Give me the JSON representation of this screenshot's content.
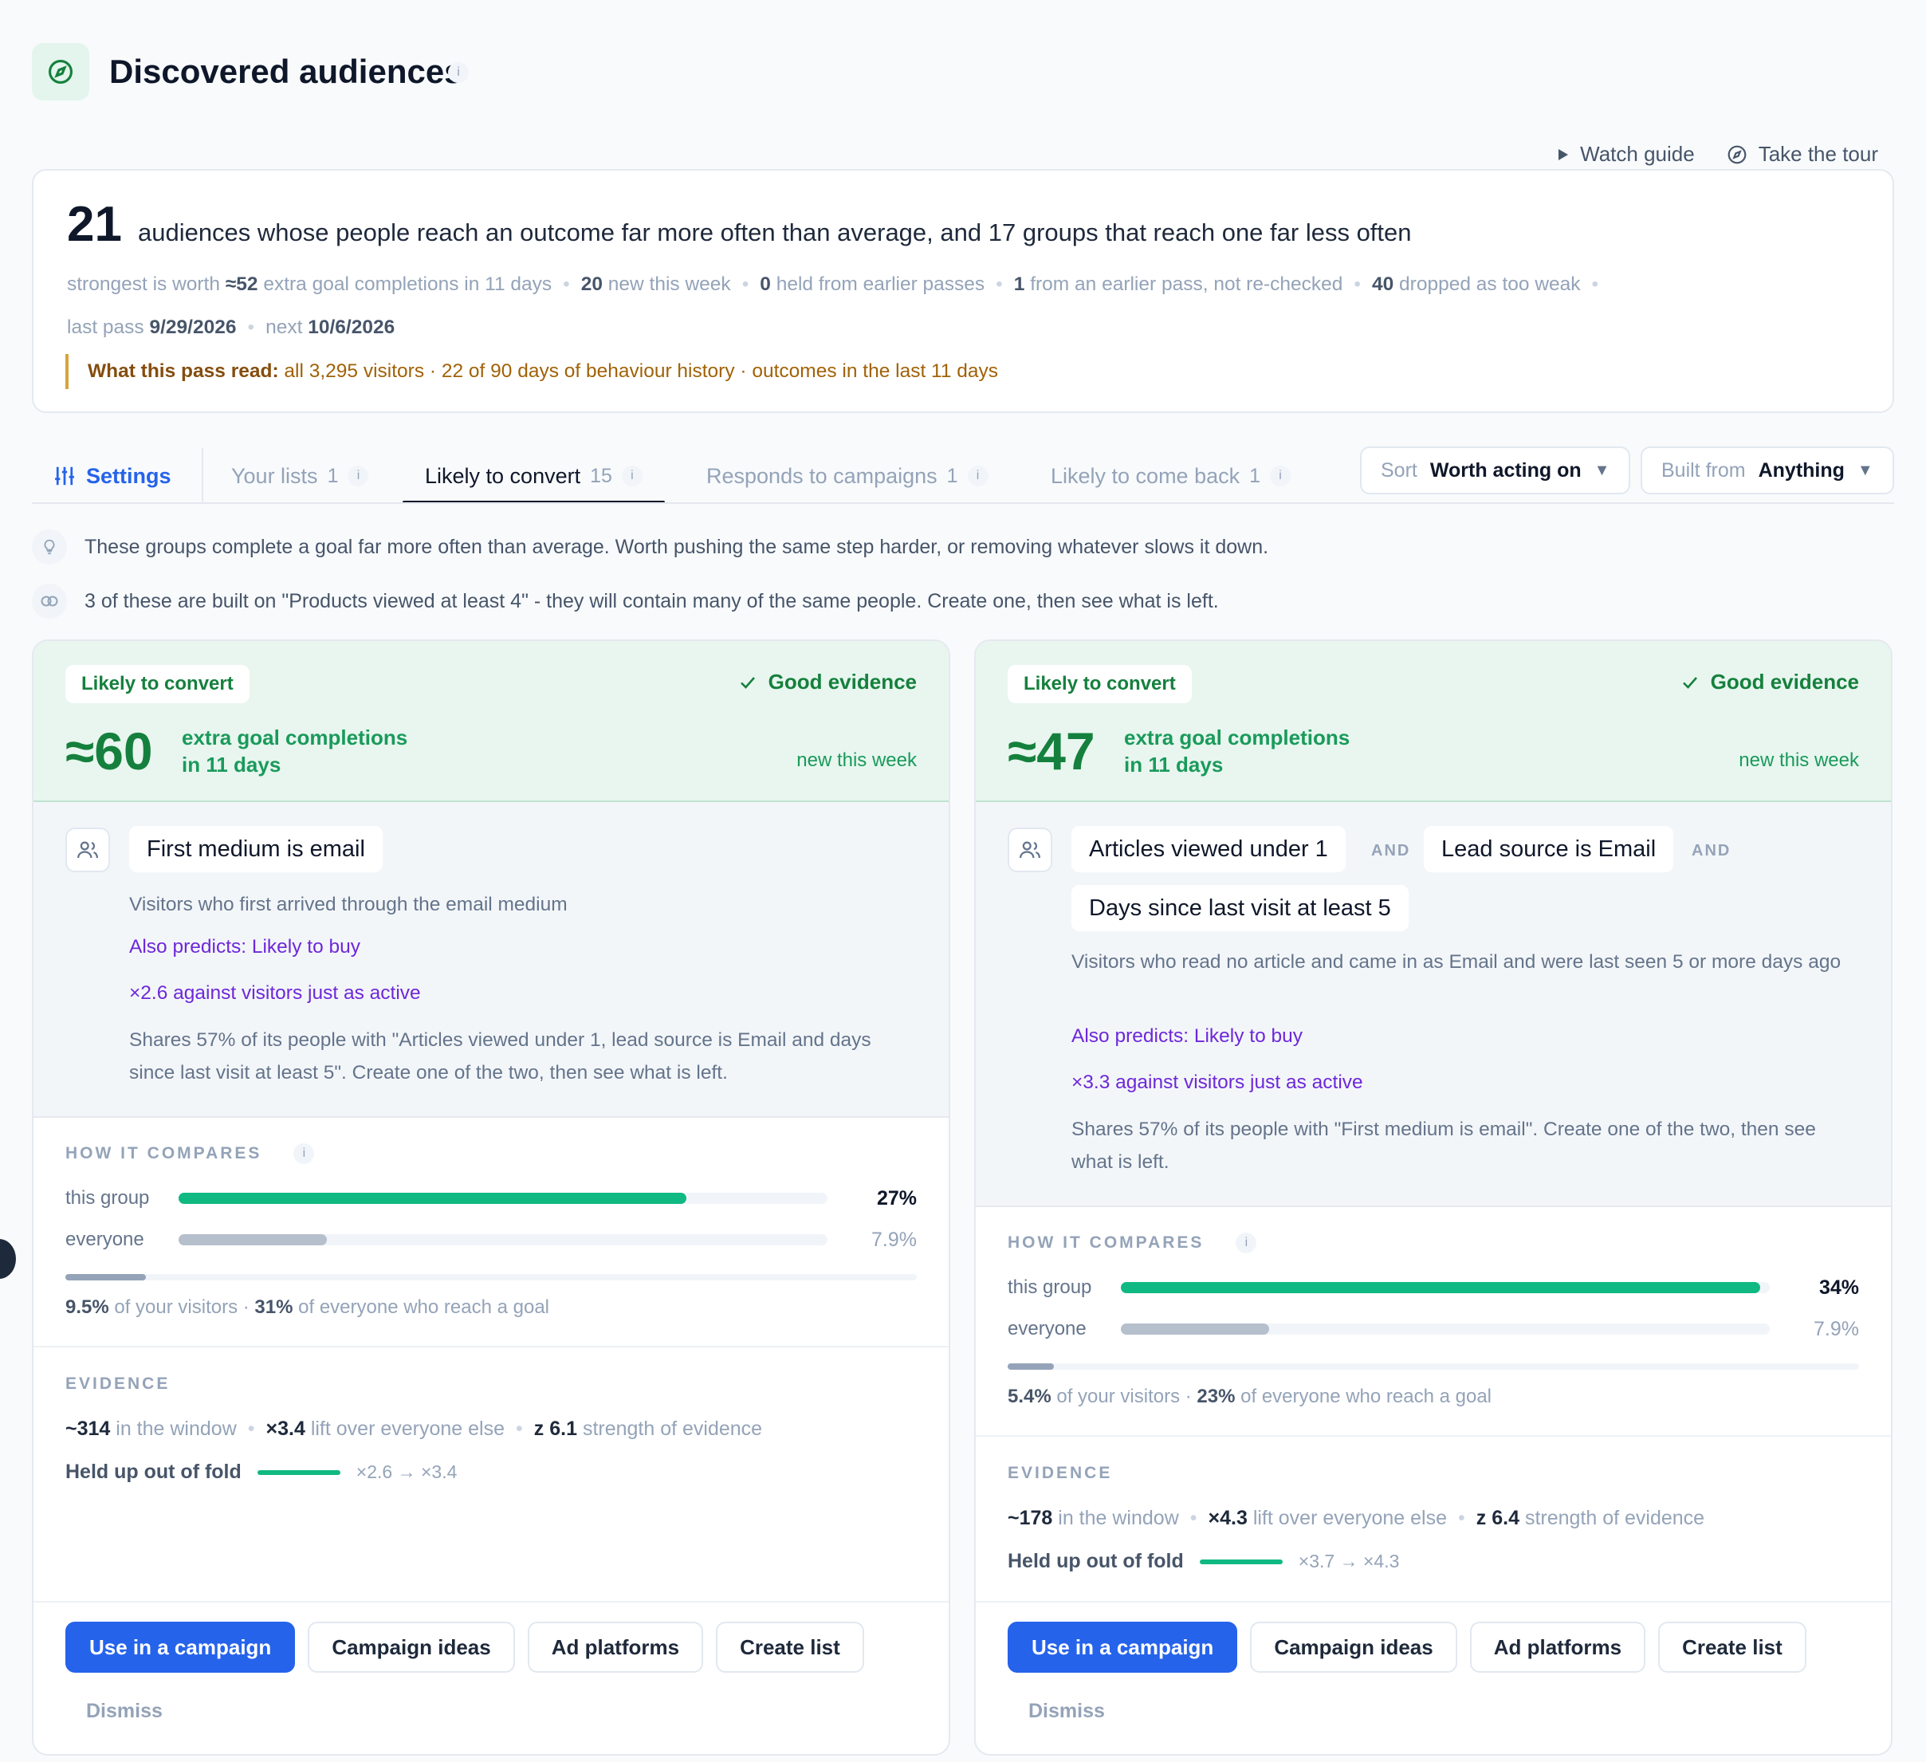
{
  "header": {
    "title": "Discovered audiences",
    "info": "i",
    "watch_guide": "Watch guide",
    "take_tour": "Take the tour"
  },
  "summary": {
    "count": "21",
    "headline": "audiences whose people reach an outcome far more often than average, and 17 groups that reach one far less often",
    "m1_pre": "strongest is worth",
    "m1_val": "≈52",
    "m1_post": "extra goal completions in 11 days",
    "m2_val": "20",
    "m2_post": "new this week",
    "m3_val": "0",
    "m3_post": "held from earlier passes",
    "m4_val": "1",
    "m4_post": "from an earlier pass, not re-checked",
    "m5_val": "40",
    "m5_post": "dropped as too weak",
    "m6_pre": "last pass",
    "m6_val": "9/29/2026",
    "m7_pre": "next",
    "m7_val": "10/6/2026",
    "note_label": "What this pass read:",
    "note_text": "all 3,295 visitors · 22 of 90 days of behaviour history · outcomes in the last 11 days"
  },
  "tabs": {
    "settings": "Settings",
    "items": [
      {
        "label": "Your lists",
        "count": "1"
      },
      {
        "label": "Likely to convert",
        "count": "15"
      },
      {
        "label": "Responds to campaigns",
        "count": "1"
      },
      {
        "label": "Likely to come back",
        "count": "1"
      }
    ],
    "sort_label": "Sort",
    "sort_value": "Worth acting on",
    "built_label": "Built from",
    "built_value": "Anything"
  },
  "hints": {
    "h1": "These groups complete a goal far more often than average. Worth pushing the same step harder, or removing whatever slows it down.",
    "h2": "3 of these are built on \"Products viewed at least 4\" - they will contain many of the same people. Create one, then see what is left."
  },
  "common": {
    "pill": "Likely to convert",
    "good": "Good evidence",
    "big_label_1": "extra goal completions",
    "big_label_2": "in 11 days",
    "new_week": "new this week",
    "and": "AND",
    "compare_label": "HOW IT COMPARES",
    "this_group": "this group",
    "everyone": "everyone",
    "of_visitors": "of your visitors ·",
    "of_everyone": "of everyone who reach a goal",
    "evidence_label": "EVIDENCE",
    "in_window": "in the window",
    "lift": "lift over everyone else",
    "strength": "strength of evidence",
    "held": "Held up out of fold",
    "btn_use": "Use in a campaign",
    "btn_ideas": "Campaign ideas",
    "btn_ads": "Ad platforms",
    "btn_create": "Create list",
    "dismiss": "Dismiss"
  },
  "cards": [
    {
      "big": "≈60",
      "chips": [
        "First medium is email"
      ],
      "desc": "Visitors who first arrived through the email medium",
      "also": "Also predicts: Likely to buy",
      "against": "×2.6 against visitors just as active",
      "shares": "Shares 57% of its people with \"Articles viewed under 1, lead source is Email and days since last visit at least 5\". Create one of the two, then see what is left.",
      "group_pct": "27%",
      "group_value": 0.27,
      "everyone_pct": "7.9%",
      "everyone_value": 0.079,
      "visitors_pct": "9.5%",
      "visitors_value": 0.095,
      "reach_pct": "31%",
      "window": "~314",
      "lift": "×3.4",
      "z": "z 6.1",
      "fold_range": "×2.6 → ×3.4"
    },
    {
      "big": "≈47",
      "chips": [
        "Articles viewed under 1",
        "Lead source is Email",
        "Days since last visit at least 5"
      ],
      "desc": "Visitors who read no article and came in as Email and were last seen 5 or more days ago",
      "also": "Also predicts: Likely to buy",
      "against": "×3.3 against visitors just as active",
      "shares": "Shares 57% of its people with \"First medium is email\". Create one of the two, then see what is left.",
      "group_pct": "34%",
      "group_value": 0.34,
      "everyone_pct": "7.9%",
      "everyone_value": 0.079,
      "visitors_pct": "5.4%",
      "visitors_value": 0.054,
      "reach_pct": "23%",
      "window": "~178",
      "lift": "×4.3",
      "z": "z 6.4",
      "fold_range": "×3.7 → ×4.3"
    }
  ],
  "colors": {
    "accent": "#2563eb",
    "good_green": "#15803d",
    "bar_green": "#10b981",
    "bar_grey": "#b6bfcc",
    "purple": "#6d28d9",
    "note_amber": "#a16207"
  }
}
